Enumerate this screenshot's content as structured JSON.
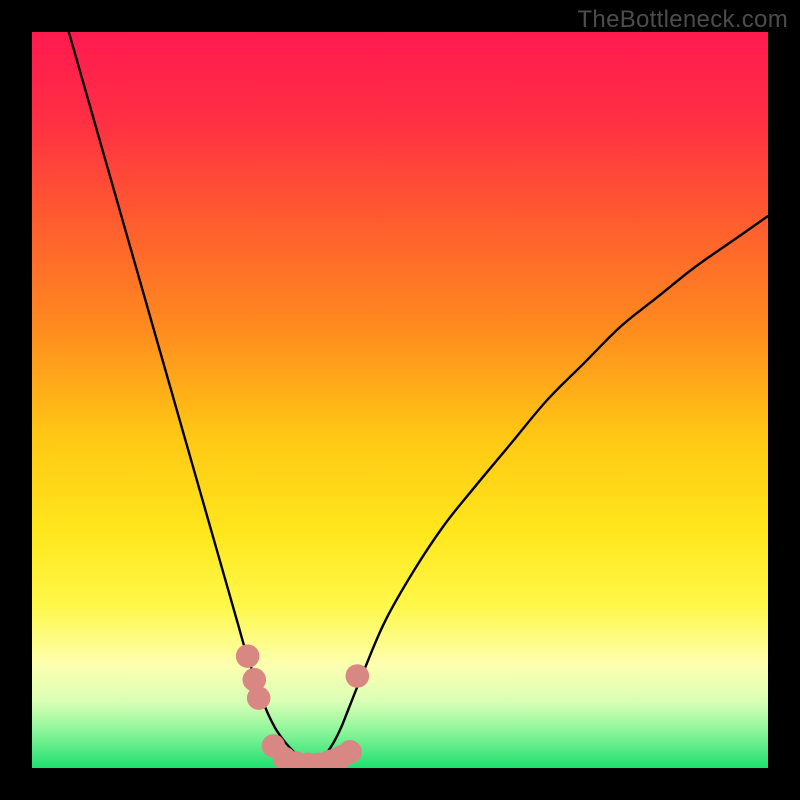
{
  "watermark": "TheBottleneck.com",
  "chart_data": {
    "type": "line",
    "title": "",
    "xlabel": "",
    "ylabel": "",
    "xlim": [
      0,
      100
    ],
    "ylim": [
      0,
      100
    ],
    "grid": false,
    "legend": false,
    "background_gradient_stops": [
      {
        "offset": 0.0,
        "color": "#ff1a4f"
      },
      {
        "offset": 0.12,
        "color": "#ff2f44"
      },
      {
        "offset": 0.25,
        "color": "#ff5a2f"
      },
      {
        "offset": 0.4,
        "color": "#ff8a1f"
      },
      {
        "offset": 0.55,
        "color": "#ffc814"
      },
      {
        "offset": 0.68,
        "color": "#ffe71d"
      },
      {
        "offset": 0.78,
        "color": "#fff84a"
      },
      {
        "offset": 0.86,
        "color": "#fdffb0"
      },
      {
        "offset": 0.91,
        "color": "#d9ffb6"
      },
      {
        "offset": 0.95,
        "color": "#8cf59a"
      },
      {
        "offset": 1.0,
        "color": "#1ee070"
      }
    ],
    "series": [
      {
        "name": "left-branch",
        "stroke": "#000000",
        "x": [
          5,
          7,
          9,
          11,
          13,
          15,
          17,
          19,
          21,
          23,
          25,
          27,
          28,
          29,
          30,
          31,
          32,
          33,
          34,
          35,
          36,
          37,
          38
        ],
        "y": [
          100,
          93,
          86,
          79,
          72,
          65,
          58,
          51,
          44,
          37,
          30,
          23,
          19.5,
          16,
          13,
          10,
          7.5,
          5.5,
          4,
          2.8,
          1.8,
          1.0,
          0.5
        ]
      },
      {
        "name": "right-branch",
        "stroke": "#000000",
        "x": [
          38,
          39,
          40,
          41,
          42,
          43,
          45,
          48,
          52,
          56,
          60,
          65,
          70,
          75,
          80,
          85,
          90,
          95,
          100
        ],
        "y": [
          0.5,
          1.0,
          2.0,
          3.5,
          5.5,
          8,
          13,
          20,
          27,
          33,
          38,
          44,
          50,
          55,
          60,
          64,
          68,
          71.5,
          75
        ]
      }
    ],
    "markers": {
      "name": "bottom-cluster",
      "color": "#d98783",
      "radius_pct": 1.6,
      "points": [
        {
          "x": 29.3,
          "y": 15.2
        },
        {
          "x": 30.2,
          "y": 12.0
        },
        {
          "x": 30.8,
          "y": 9.5
        },
        {
          "x": 32.8,
          "y": 3.0
        },
        {
          "x": 34.3,
          "y": 1.3
        },
        {
          "x": 35.8,
          "y": 0.7
        },
        {
          "x": 37.5,
          "y": 0.5
        },
        {
          "x": 39.0,
          "y": 0.5
        },
        {
          "x": 40.5,
          "y": 0.9
        },
        {
          "x": 42.0,
          "y": 1.5
        },
        {
          "x": 43.2,
          "y": 2.2
        },
        {
          "x": 44.2,
          "y": 12.5
        }
      ]
    }
  }
}
